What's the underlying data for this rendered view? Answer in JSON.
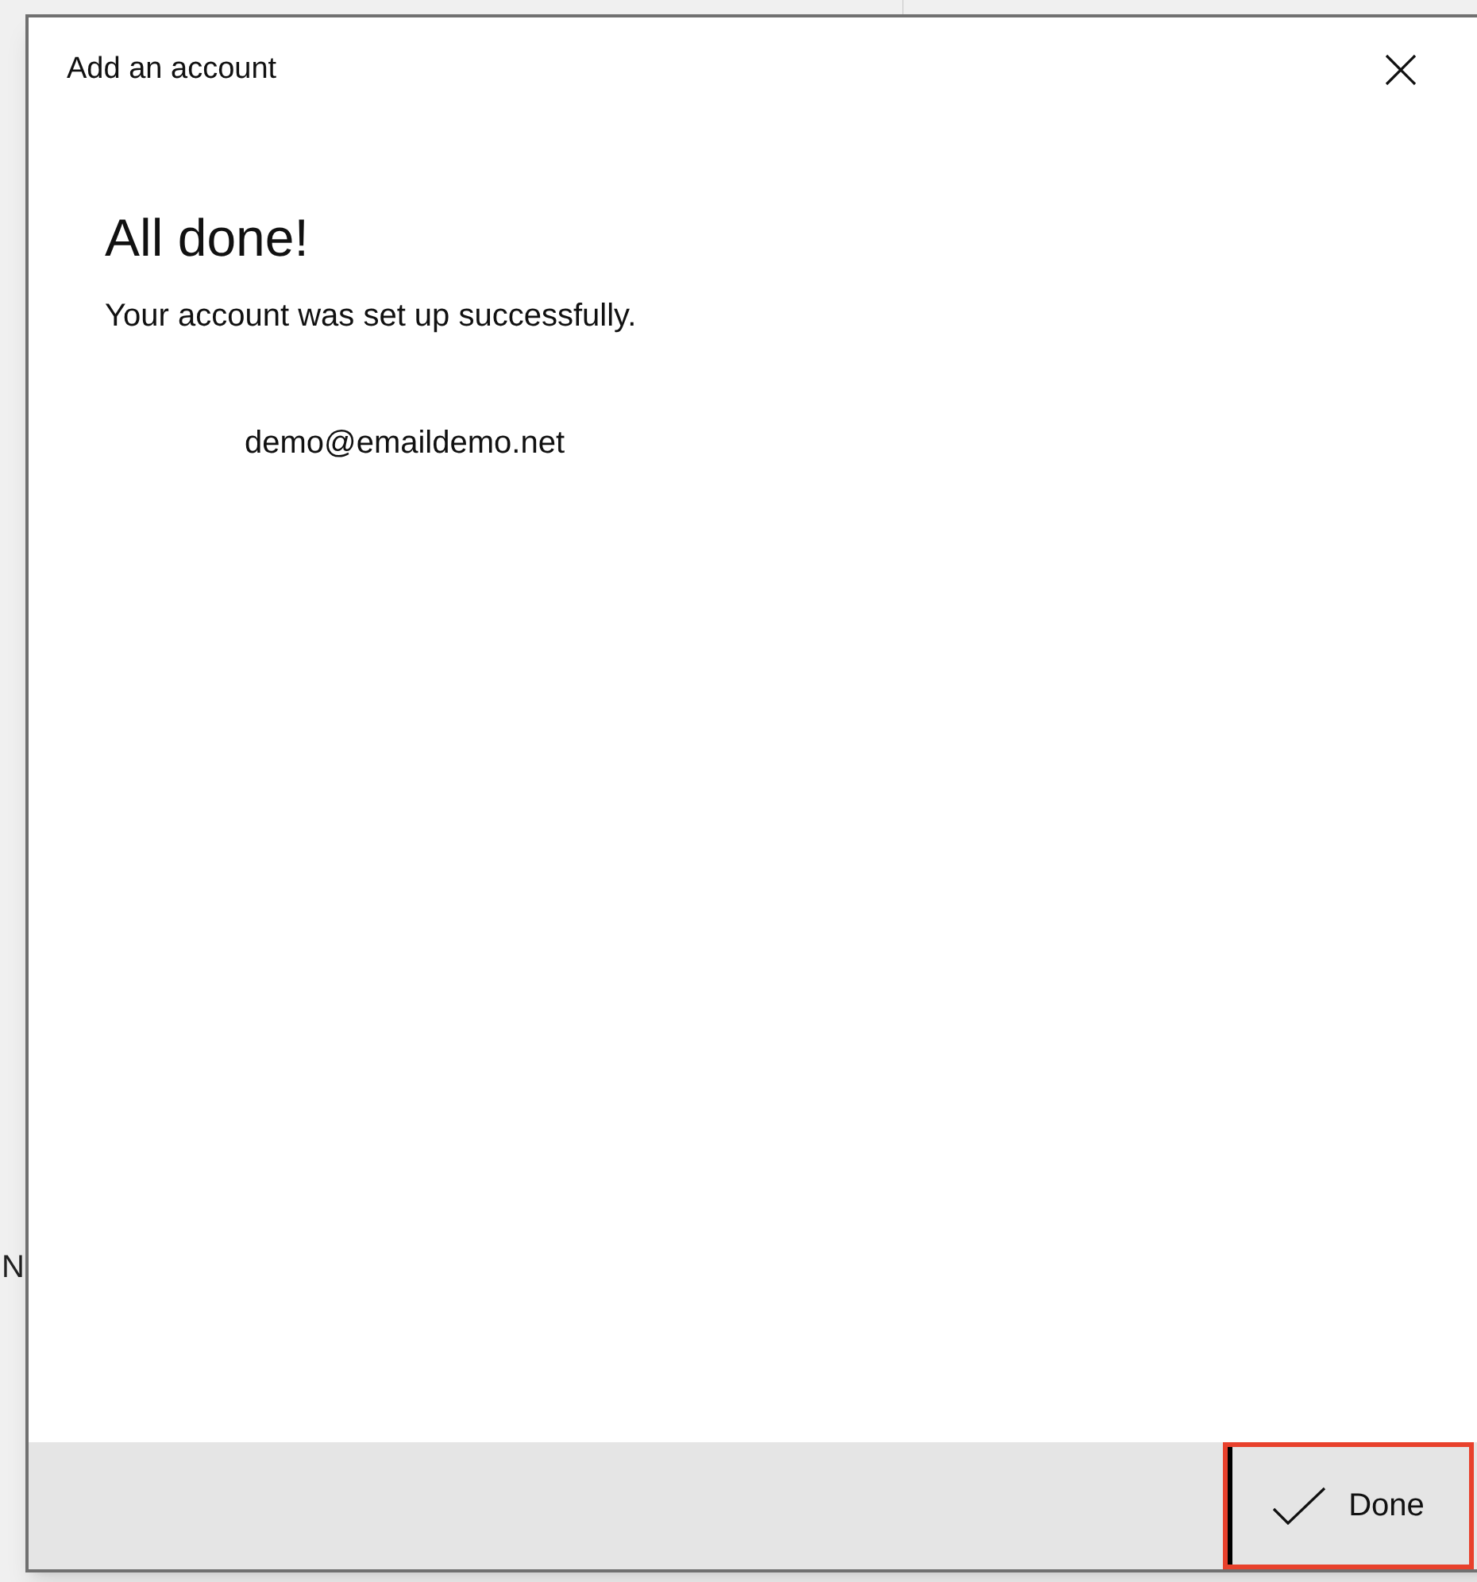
{
  "background_text": "N",
  "dialog": {
    "title": "Add an account",
    "heading": "All done!",
    "message": "Your account was set up successfully.",
    "account": "demo@emaildemo.net"
  },
  "footer": {
    "done_button": {
      "label": "Done",
      "highlighted": true
    }
  }
}
